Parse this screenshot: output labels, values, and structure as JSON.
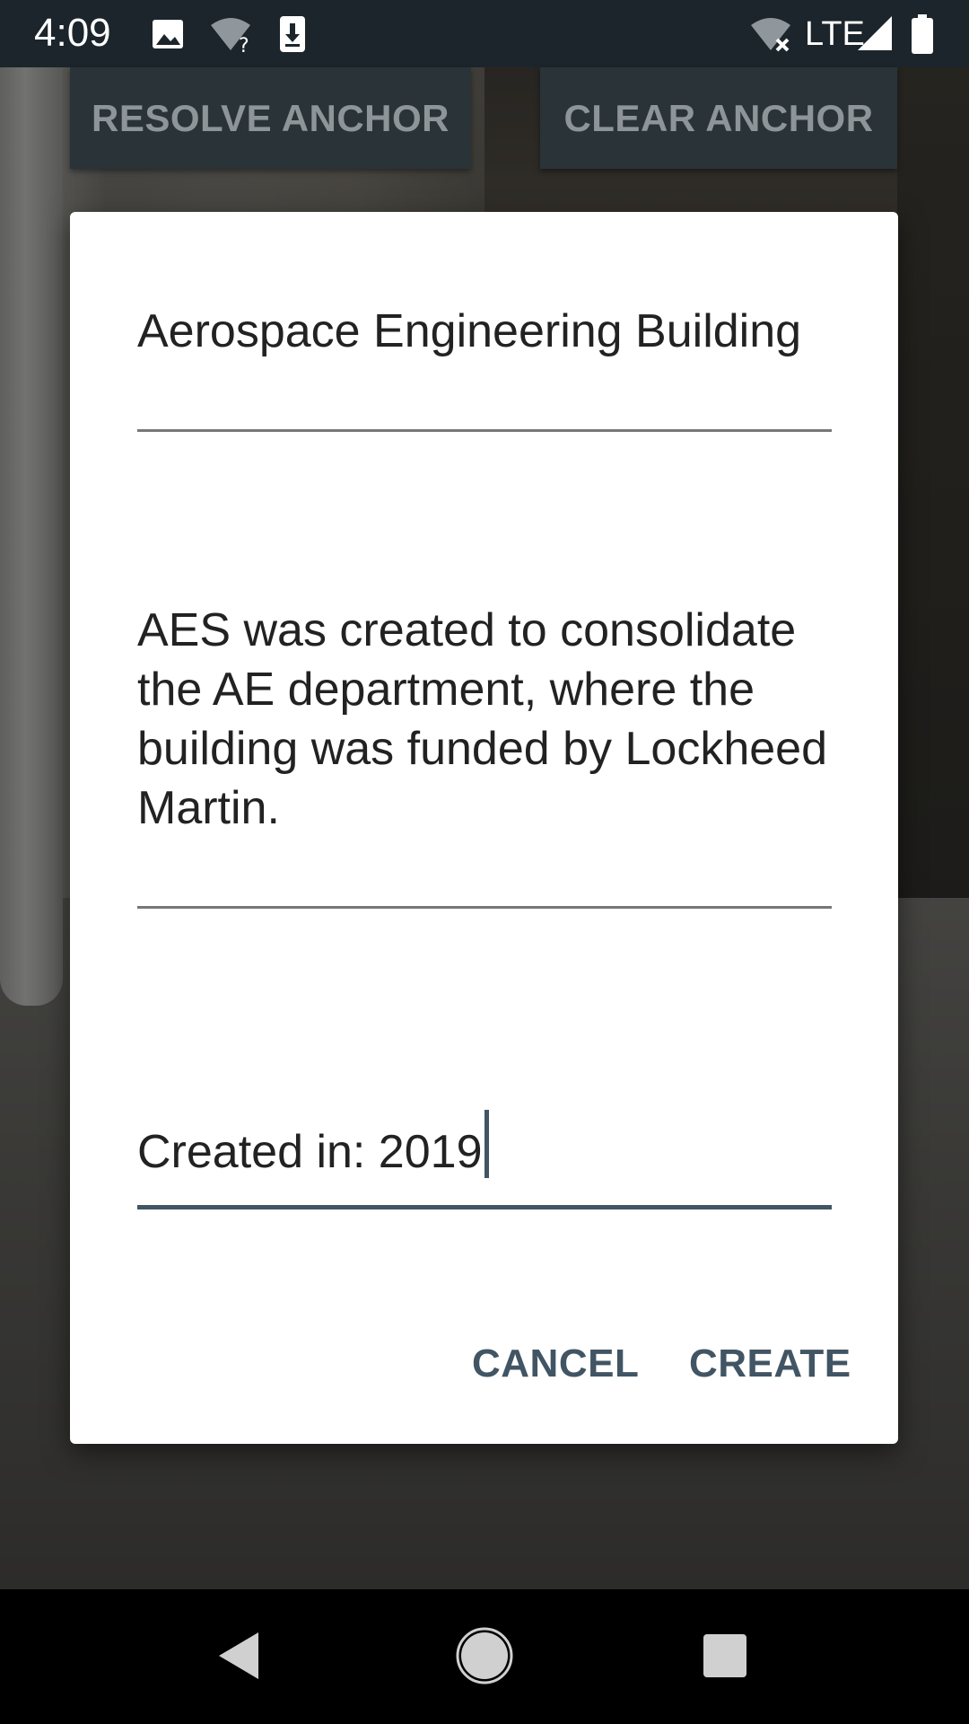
{
  "status_bar": {
    "time": "4:09",
    "network_label": "LTE",
    "icons": [
      "image-icon",
      "wifi-unknown-icon",
      "download-icon",
      "wifi-off-icon",
      "signal-icon",
      "battery-icon"
    ]
  },
  "anchor_controls": {
    "resolve_label": "RESOLVE ANCHOR",
    "clear_label": "CLEAR ANCHOR"
  },
  "dialog": {
    "title_value": "Aerospace Engineering Building",
    "description_value": "AES was created to consolidate the AE department, where the building was funded by Lockheed Martin.",
    "year_value": "Created in: 2019",
    "cancel_label": "CANCEL",
    "create_label": "CREATE",
    "accent_color": "#415564"
  },
  "nav_bar": {
    "icons": [
      "back-icon",
      "home-icon",
      "recents-icon"
    ]
  }
}
